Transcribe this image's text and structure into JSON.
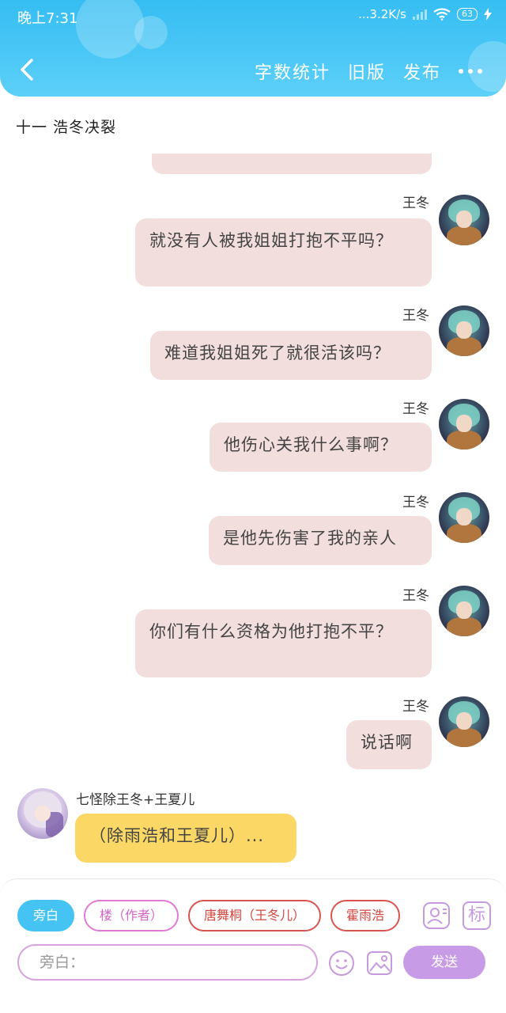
{
  "status_bar": {
    "time": "晚上7:31",
    "network_speed": "...3.2K/s",
    "battery": "63"
  },
  "toolbar": {
    "word_count_label": "字数统计",
    "old_version_label": "旧版",
    "publish_label": "发布"
  },
  "chapter": {
    "title": "十一 浩冬决裂"
  },
  "messages": [
    {
      "sender": "王冬",
      "text": "就没有人被我姐姐打抱不平吗？"
    },
    {
      "sender": "王冬",
      "text": "难道我姐姐死了就很活该吗？"
    },
    {
      "sender": "王冬",
      "text": "他伤心关我什么事啊？"
    },
    {
      "sender": "王冬",
      "text": "是他先伤害了我的亲人"
    },
    {
      "sender": "王冬",
      "text": "你们有什么资格为他打抱不平？"
    },
    {
      "sender": "王冬",
      "text": "说话啊"
    }
  ],
  "left_message": {
    "sender": "七怪除王冬+王夏儿",
    "text": "（除雨浩和王夏儿）..."
  },
  "roles": [
    {
      "label": "旁白",
      "active": true
    },
    {
      "label": "楼（作者）",
      "active": false
    },
    {
      "label": "唐舞桐（王冬儿）",
      "active": false
    },
    {
      "label": "霍雨浩",
      "active": false
    }
  ],
  "input": {
    "placeholder": "旁白："
  },
  "send_label": "发送",
  "tag_label": "标",
  "colors": {
    "header": "#36bdf2",
    "bubble_pink": "#f2dedd",
    "bubble_yellow": "#fbd865",
    "send_button": "#c89be6",
    "active_role": "#45c3f3"
  }
}
